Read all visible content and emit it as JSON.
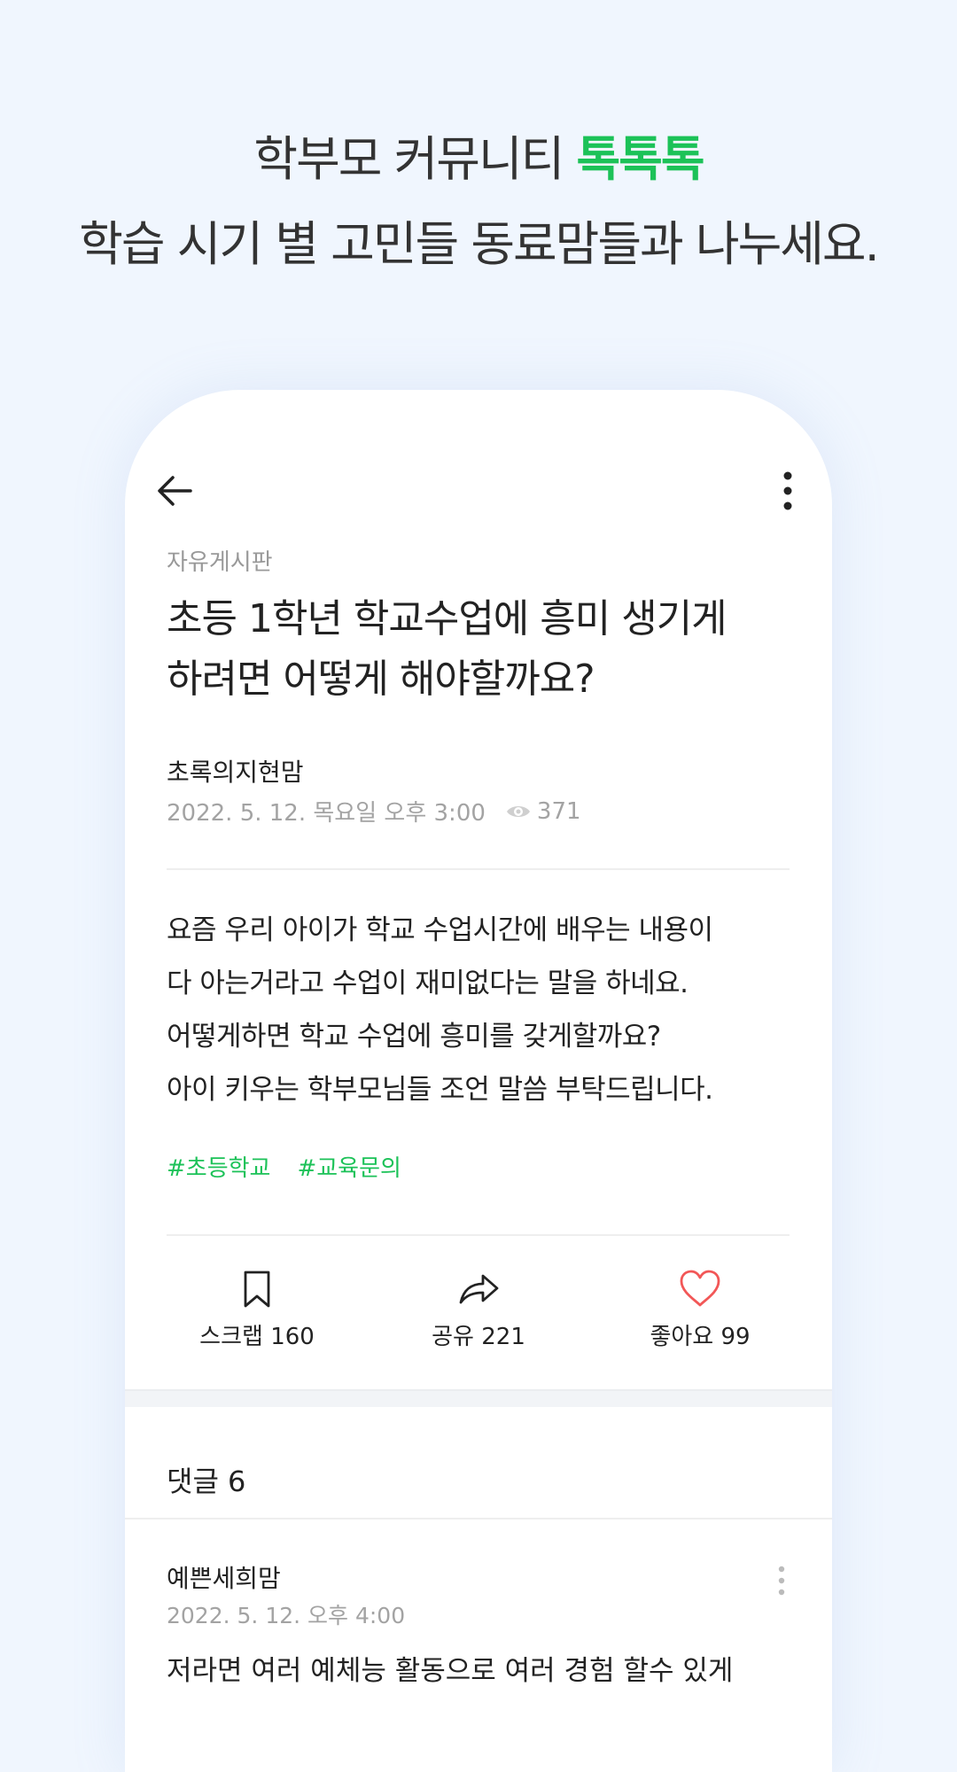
{
  "promo": {
    "line1_prefix": "학부모 커뮤니티 ",
    "line1_accent": "톡톡톡",
    "line2": "학습 시기 별 고민들 동료맘들과 나누세요."
  },
  "post": {
    "board": "자유게시판",
    "title_lines": [
      "초등 1학년 학교수업에 흥미 생기게",
      "하려면 어떻게 해야할까요?"
    ],
    "author": "초록의지현맘",
    "date": "2022. 5. 12. 목요일 오후 3:00",
    "views": "371",
    "body_lines": [
      "요즘 우리 아이가 학교 수업시간에 배우는 내용이",
      "다 아는거라고 수업이 재미없다는 말을 하네요.",
      "어떻게하면 학교 수업에 흥미를 갖게할까요?",
      "아이 키우는 학부모님들 조언 말씀 부탁드립니다."
    ],
    "tags": [
      "#초등학교",
      "#교육문의"
    ]
  },
  "actions": {
    "scrap": "스크랩 160",
    "share": "공유 221",
    "like": "좋아요 99"
  },
  "comments": {
    "header": "댓글 6",
    "first": {
      "author": "예쁜세희맘",
      "date": "2022. 5. 12. 오후 4:00",
      "text": "저라면 여러 예체능 활동으로 여러 경험 할수 있게"
    }
  },
  "colors": {
    "accent": "#1cc258",
    "like": "#f25757",
    "background": "#f0f6fe"
  }
}
